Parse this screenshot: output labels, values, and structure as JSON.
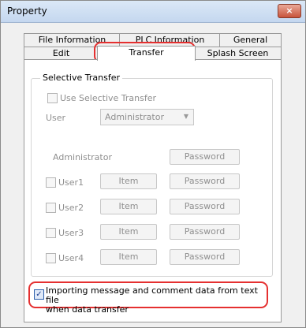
{
  "window": {
    "title": "Property",
    "close_label": "×"
  },
  "tabs_row1": [
    "File Information",
    "PLC Information",
    "General"
  ],
  "tabs_row2": [
    "Edit",
    "Transfer",
    "Splash Screen"
  ],
  "active_tab": "Transfer",
  "selective_transfer": {
    "group_label": "Selective Transfer",
    "use_label": "Use Selective Transfer",
    "user_label": "User",
    "user_value": "Administrator",
    "admin_label": "Administrator",
    "password_label": "Password",
    "item_label": "Item",
    "users": [
      "User1",
      "User2",
      "User3",
      "User4"
    ]
  },
  "import_option": {
    "checked": true,
    "label_line1": "Importing message and comment data from text file",
    "label_line2": "when data transfer"
  },
  "colors": {
    "highlight": "#e53030",
    "disabled_text": "#8f8f8f",
    "accent": "#2b5fab"
  }
}
